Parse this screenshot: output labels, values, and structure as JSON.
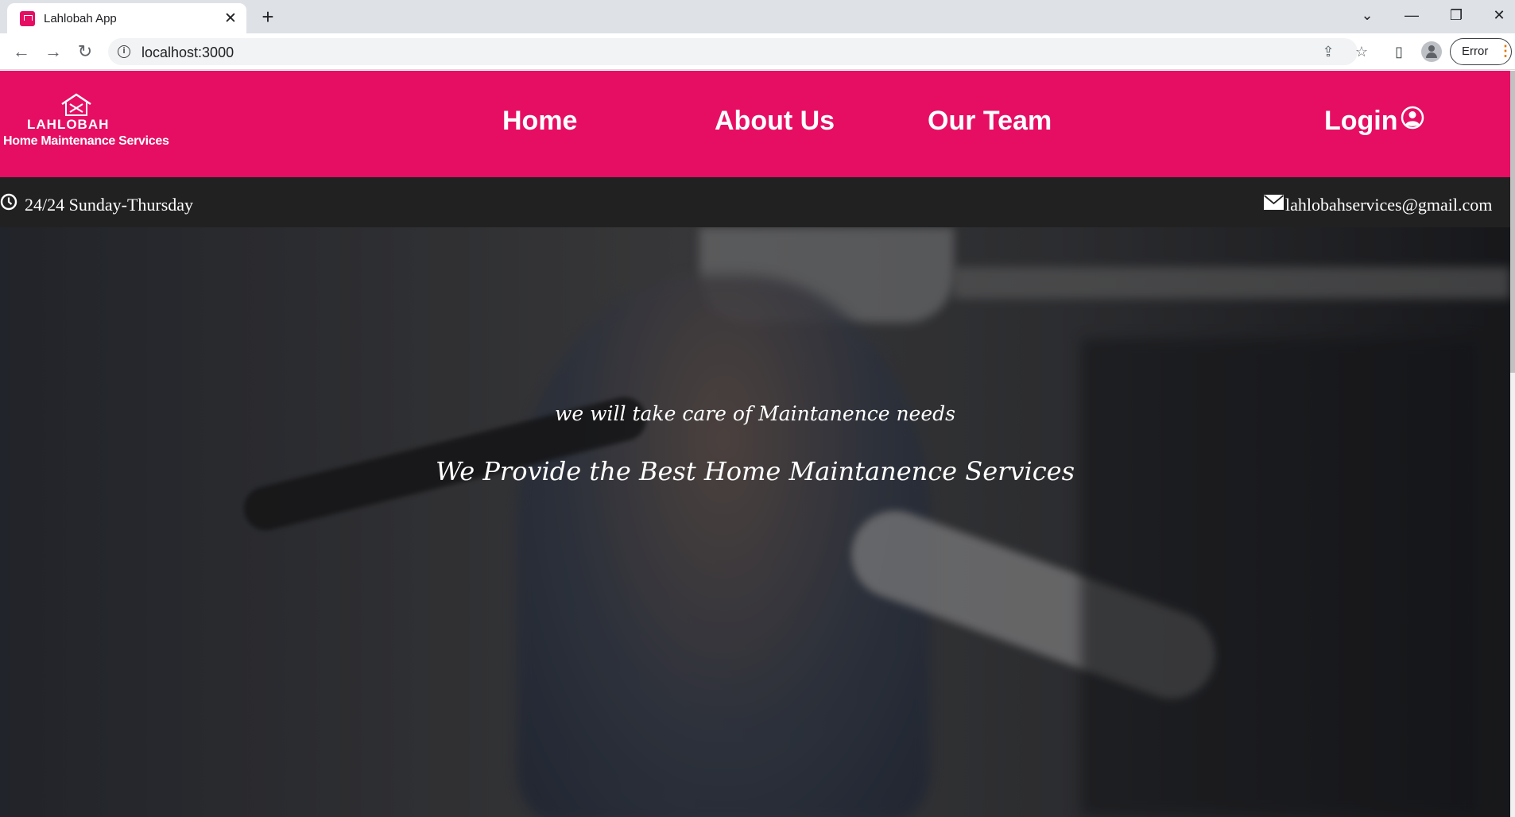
{
  "browser": {
    "tab_title": "Lahlobah App",
    "tab_close": "✕",
    "new_tab": "+",
    "url": "localhost:3000",
    "profile_status": "Error",
    "window_controls": {
      "dropdown": "⌄",
      "minimize": "—",
      "restore": "❐",
      "close": "✕"
    },
    "nav_icons": {
      "back": "←",
      "forward": "→",
      "reload": "↻"
    },
    "omnibox_icons": {
      "share": "⇪",
      "bookmark": "☆"
    },
    "side_panel_icon": "▯"
  },
  "site": {
    "brand_color": "#e60e63",
    "logo": {
      "name": "LAHLOBAH",
      "tagline": "Home Maintenance Services"
    },
    "nav": {
      "home": "Home",
      "about": "About Us",
      "team": "Our Team",
      "login": "Login"
    },
    "infobar": {
      "hours": "24/24 Sunday-Thursday",
      "email": "lahlobahservices@gmail.com"
    },
    "hero": {
      "subtitle": "we will take care of Maintanence needs",
      "title": "We Provide the Best Home Maintanence Services"
    }
  }
}
